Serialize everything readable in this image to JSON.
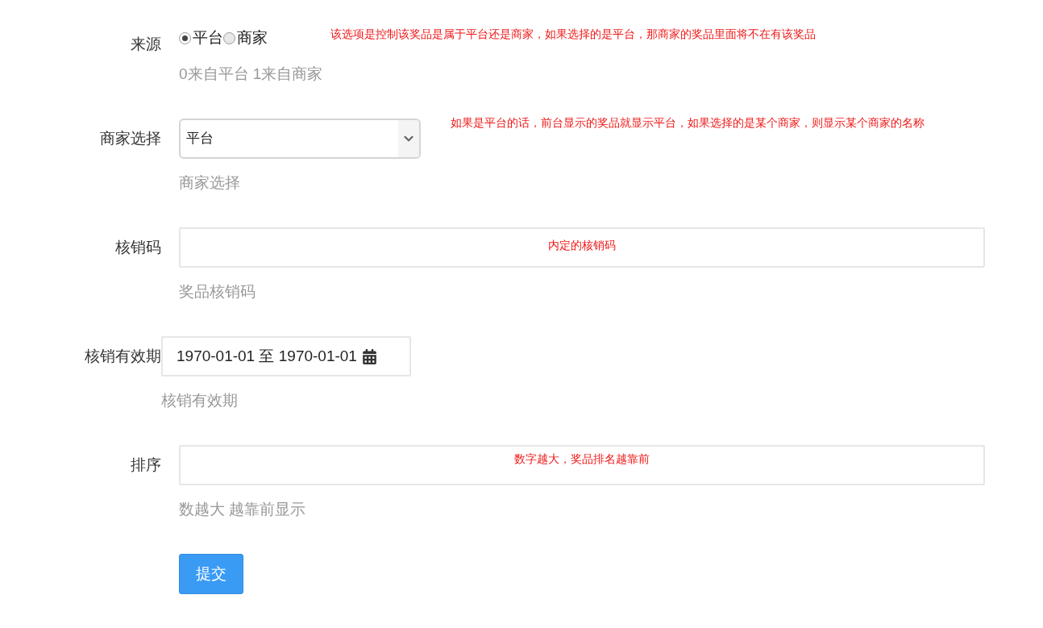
{
  "fields": [
    {
      "kind": "radio",
      "label": "来源",
      "options": [
        {
          "label": "平台",
          "selected": true
        },
        {
          "label": "商家",
          "selected": false
        }
      ],
      "help": "0来自平台 1来自商家",
      "note": "该选项是控制该奖品是属于平台还是商家，如果选择的是平台，那商家的奖品里面将不在有该奖品"
    },
    {
      "kind": "select",
      "label": "商家选择",
      "value": "平台",
      "help": "商家选择",
      "note": "如果是平台的话，前台显示的奖品就显示平台，如果选择的是某个商家，则显示某个商家的名称"
    },
    {
      "kind": "text",
      "label": "核销码",
      "help": "奖品核销码",
      "note": "内定的核销码"
    },
    {
      "kind": "daterange",
      "label": "核销有效期",
      "value": "1970-01-01 至 1970-01-01",
      "help": "核销有效期"
    },
    {
      "kind": "text",
      "label": "排序",
      "help": "数越大 越靠前显示",
      "note": "数字越大，奖品排名越靠前"
    }
  ],
  "submit": "提交"
}
